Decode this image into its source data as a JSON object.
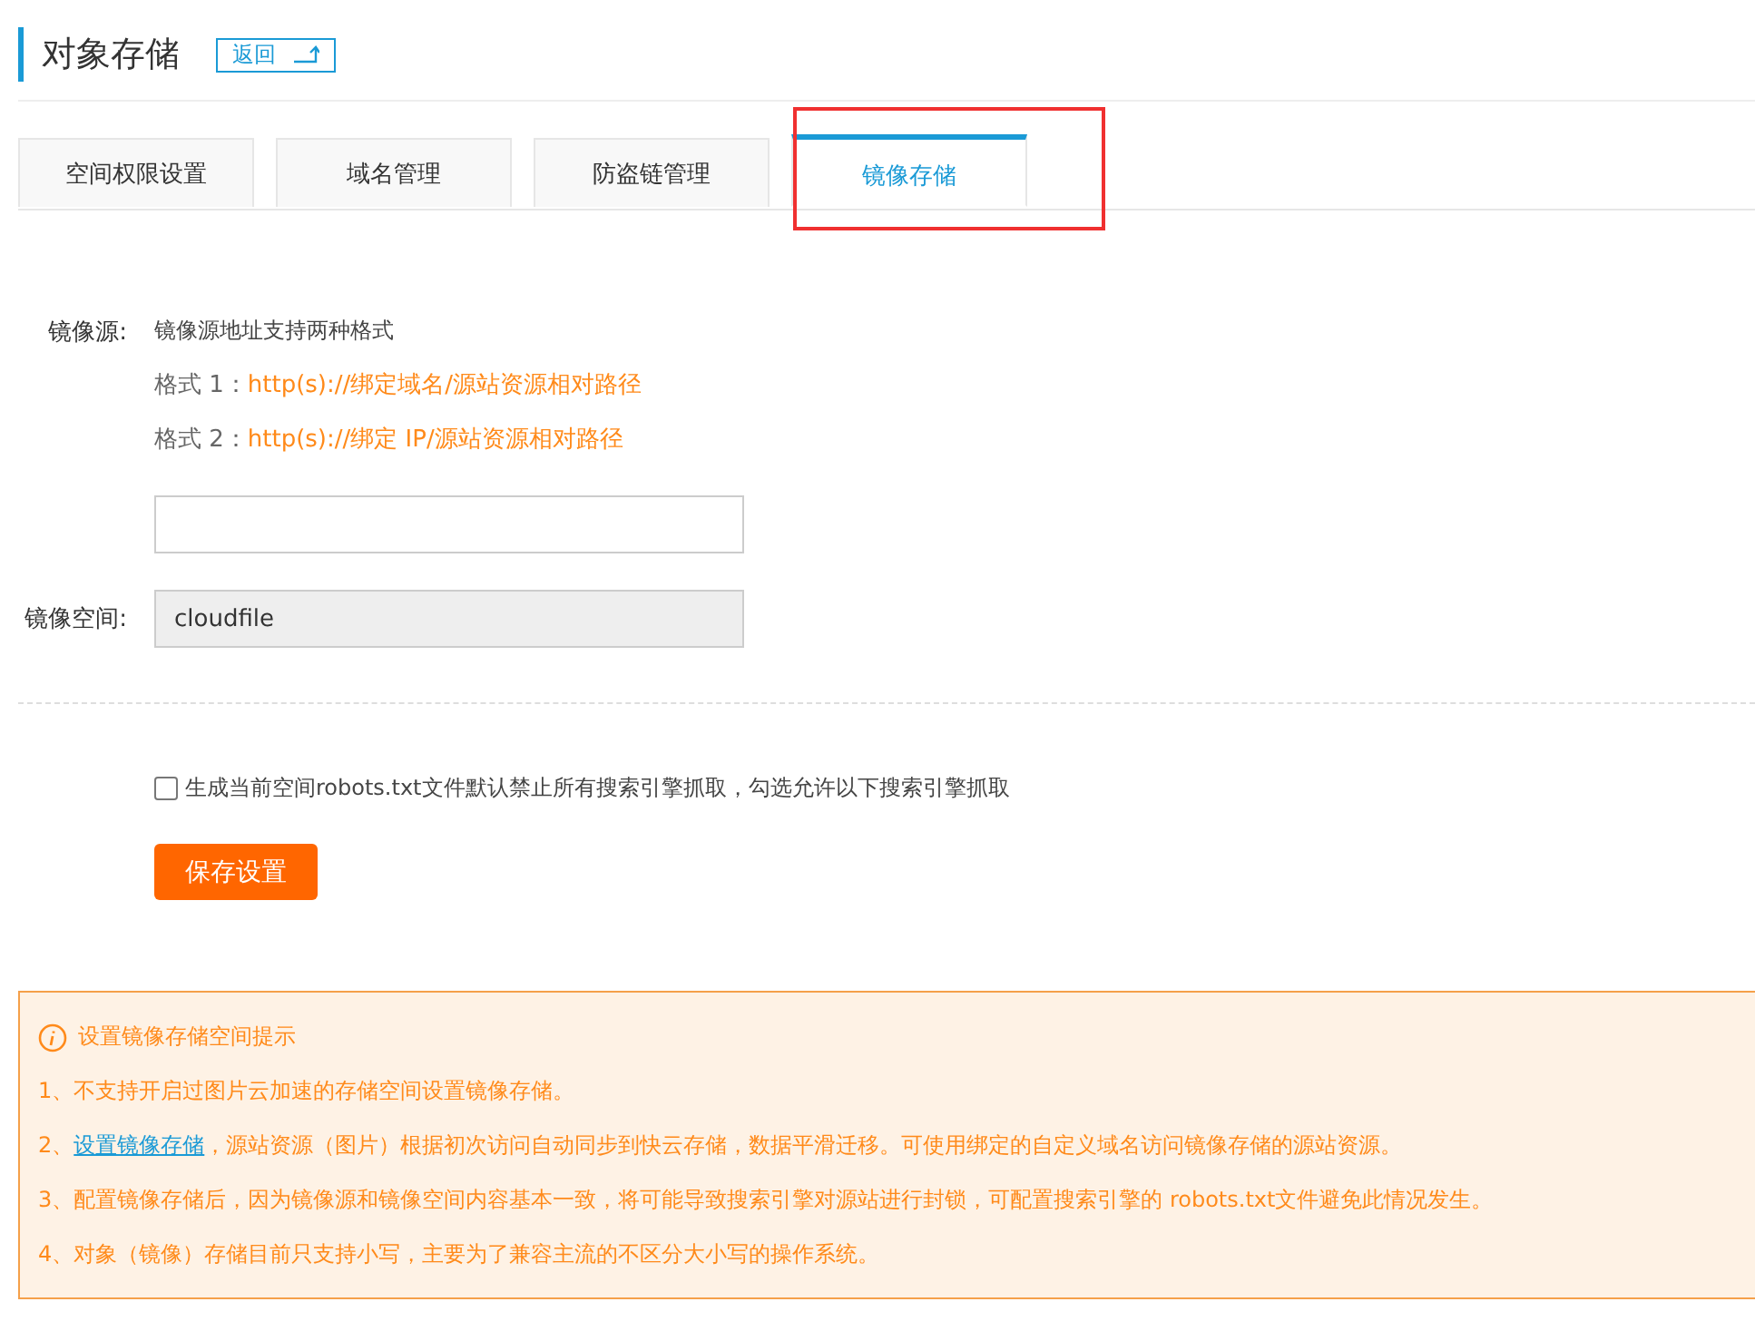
{
  "header": {
    "title": "对象存储",
    "back_button": "返回"
  },
  "tabs": [
    {
      "label": "空间权限设置",
      "selected": false
    },
    {
      "label": "域名管理",
      "selected": false
    },
    {
      "label": "防盗链管理",
      "selected": false
    },
    {
      "label": "镜像存储",
      "selected": true,
      "highlighted": true
    }
  ],
  "mirror_source": {
    "label": "镜像源:",
    "hint": "镜像源地址支持两种格式",
    "formats": [
      {
        "prefix": "格式 1：",
        "url": "http(s)://绑定域名/源站资源相对路径"
      },
      {
        "prefix": "格式 2：",
        "url": "http(s)://绑定 IP/源站资源相对路径"
      }
    ]
  },
  "mirror_space": {
    "label": "镜像空间:",
    "value": "cloudfile",
    "disabled": true
  },
  "robots_checkbox": {
    "label": "生成当前空间robots.txt文件默认禁止所有搜索引擎抓取，勾选允许以下搜索引擎抓取",
    "checked": false
  },
  "save_button": "保存设置",
  "notes": {
    "title": "设置镜像存储空间提示",
    "items": [
      {
        "text": "1、不支持开启过图片云加速的存储空间设置镜像存储。"
      },
      {
        "prefix": "2、",
        "link": "设置镜像存储",
        "text": "，源站资源（图片）根据初次访问自动同步到快云存储，数据平滑迁移。可使用绑定的自定义域名访问镜像存储的源站资源。"
      },
      {
        "text": "3、配置镜像存储后，因为镜像源和镜像空间内容基本一致，将可能导致搜索引擎对源站进行封锁，可配置搜索引擎的 robots.txt文件避免此情况发生。"
      },
      {
        "text": "4、对象（镜像）存储目前只支持小写，主要为了兼容主流的不区分大小写的操作系统。"
      }
    ]
  }
}
